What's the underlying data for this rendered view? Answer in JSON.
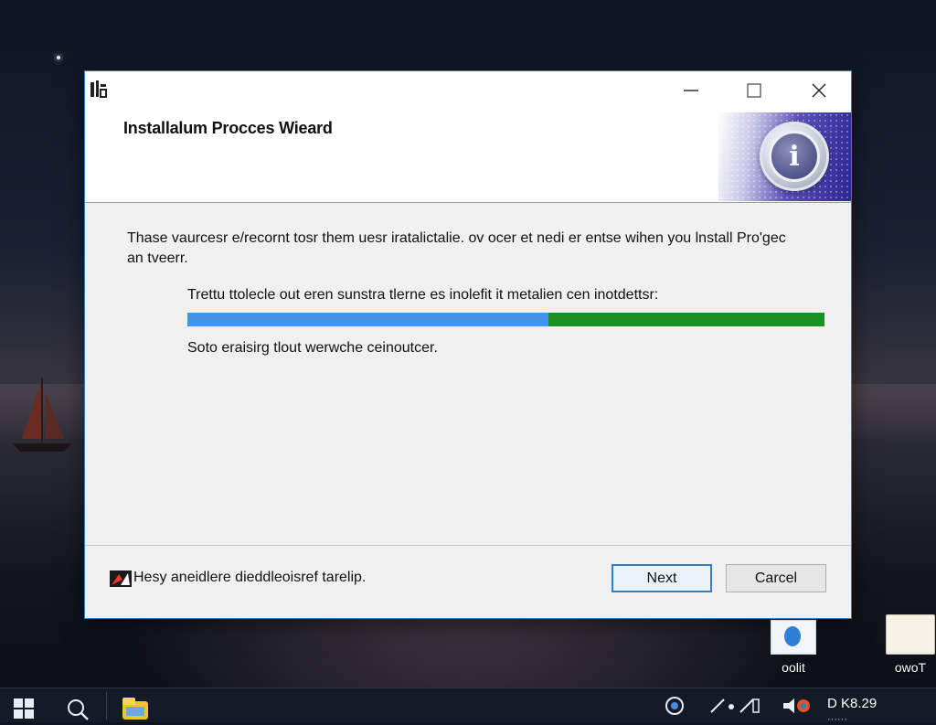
{
  "window": {
    "title": "Installalum Procces Wieard",
    "controls": {
      "minimize": "minimize-icon",
      "maximize": "maximize-icon",
      "close": "close-icon"
    }
  },
  "content": {
    "intro": "Thase vaurcesr e/recornt tosr them uesr iratalictalie. ov ocer et nedi er entse wihen you lnstall Pro'gec an tveerr.",
    "progress_label": "Trettu ttolecle out eren sunstra tlerne es inolefit it metalien cen inotdettsr:",
    "progress_value": 0.567,
    "progress_colors": {
      "fill": "#3f95e8",
      "track": "#1a8f22"
    },
    "status": "Soto eraisirg tlout werwche ceinoutcer."
  },
  "footer": {
    "help_text": "Hesy aneidlere dieddleoisref tarelip.",
    "next_label": "Next",
    "cancel_label": "Carcel"
  },
  "desktop": {
    "icons": [
      {
        "label": "oolit"
      },
      {
        "label": "owoT"
      }
    ]
  },
  "taskbar": {
    "clock": "D K8.29",
    "accent": "#2d7fc8"
  }
}
